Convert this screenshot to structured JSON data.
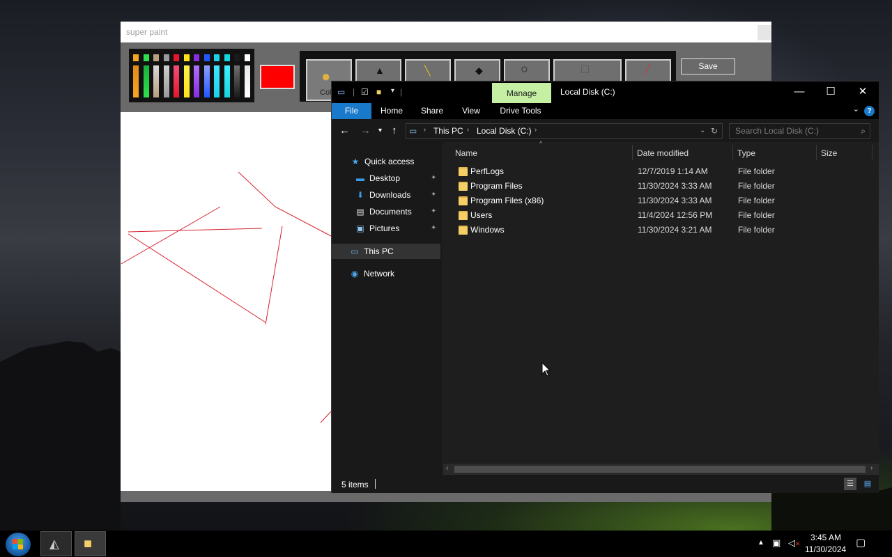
{
  "paint": {
    "title": "super paint",
    "color_tool_label": "Col",
    "save_label": "Save",
    "current_color": "#ff0000",
    "palette_top": [
      "#f5a623",
      "#2ee04b",
      "#b8a080",
      "#9a9a9a",
      "#e8162c",
      "#ffe21a",
      "#8a2be2",
      "#2356ff",
      "#1ecfe8",
      "#14d6e0",
      "#1a1a1a",
      "#ffffff"
    ],
    "palette_bottom": [
      "#e28a1a",
      "#19b338",
      "#d8d8d8",
      "#d0d0d0",
      "#f24d7a",
      "#fff04d",
      "#b070ff",
      "#8fa0ff",
      "#40e8ff",
      "#40f0ff",
      "#707070",
      "#e8e8e8"
    ]
  },
  "explorer": {
    "title": "Local Disk (C:)",
    "manage_tab": "Manage",
    "ribbon_tabs": [
      "File",
      "Home",
      "Share",
      "View",
      "Drive Tools"
    ],
    "breadcrumb": [
      "This PC",
      "Local Disk (C:)"
    ],
    "search_placeholder": "Search Local Disk (C:)",
    "nav": {
      "quick_access": "Quick access",
      "desktop": "Desktop",
      "downloads": "Downloads",
      "documents": "Documents",
      "pictures": "Pictures",
      "this_pc": "This PC",
      "network": "Network"
    },
    "columns": [
      "Name",
      "Date modified",
      "Type",
      "Size"
    ],
    "files": [
      {
        "name": "PerfLogs",
        "date": "12/7/2019 1:14 AM",
        "type": "File folder",
        "size": ""
      },
      {
        "name": "Program Files",
        "date": "11/30/2024 3:33 AM",
        "type": "File folder",
        "size": ""
      },
      {
        "name": "Program Files (x86)",
        "date": "11/30/2024 3:33 AM",
        "type": "File folder",
        "size": ""
      },
      {
        "name": "Users",
        "date": "11/4/2024 12:56 PM",
        "type": "File folder",
        "size": ""
      },
      {
        "name": "Windows",
        "date": "11/30/2024 3:21 AM",
        "type": "File folder",
        "size": ""
      }
    ],
    "status": "5 items",
    "accent_color": "#1979ca",
    "manage_color": "#c5f0a4"
  },
  "taskbar": {
    "time": "3:45 AM",
    "date": "11/30/2024"
  }
}
